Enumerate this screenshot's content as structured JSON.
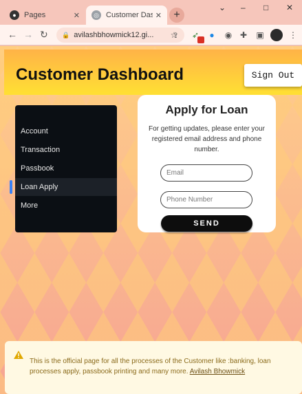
{
  "browser": {
    "tabs": [
      {
        "label": "Pages",
        "active": false
      },
      {
        "label": "Customer Dashb",
        "active": true
      }
    ],
    "url": "avilashbhowmick12.gi...",
    "window_controls": {
      "minimize": "–",
      "maximize": "□",
      "close": "✕",
      "tab_search": "⌄"
    }
  },
  "header": {
    "title": "Customer Dashboard",
    "signout_label": "Sign Out"
  },
  "sidebar": {
    "items": [
      {
        "label": "Account"
      },
      {
        "label": "Transaction"
      },
      {
        "label": "Passbook"
      },
      {
        "label": "Loan Apply",
        "active": true
      },
      {
        "label": "More"
      }
    ]
  },
  "loan": {
    "title": "Apply for Loan",
    "description": "For getting updates, please enter your registered email address and phone number.",
    "email_placeholder": "Email",
    "phone_placeholder": "Phone Number",
    "send_label": "SEND"
  },
  "footer": {
    "text": "This is the official page for all the processes of the Customer like :banking, loan processes apply, passbook printing and many more.",
    "link_text": "Avilash Bhowmick"
  },
  "colors": {
    "header_top": "#ffb347",
    "header_bottom": "#ffe033",
    "sidebar_bg": "#0b0f14",
    "sidebar_active_indicator": "#3b82f6",
    "footer_bg": "#fff9e3",
    "footer_text": "#8a6a1a"
  }
}
